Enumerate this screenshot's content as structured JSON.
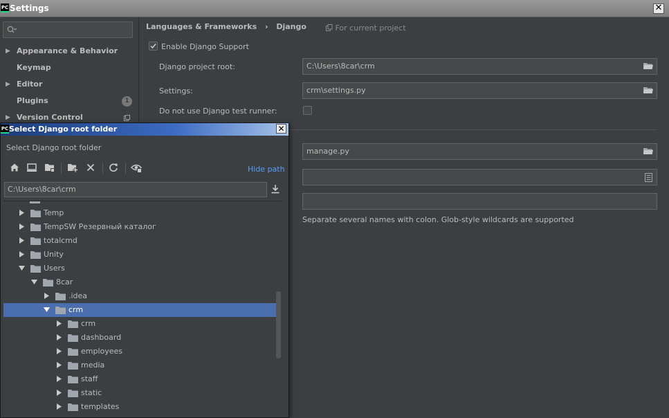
{
  "window": {
    "title": "Settings",
    "app_icon": "PC",
    "close": "✕"
  },
  "sidebar": {
    "search_placeholder": "Q",
    "items": [
      {
        "label": "Appearance & Behavior",
        "arrow": "▶"
      },
      {
        "label": "Keymap",
        "arrow": ""
      },
      {
        "label": "Editor",
        "arrow": "▶"
      },
      {
        "label": "Plugins",
        "arrow": "",
        "badge": "1"
      },
      {
        "label": "Version Control",
        "arrow": "▶"
      }
    ]
  },
  "content": {
    "breadcrumb_part1": "Languages & Frameworks",
    "breadcrumb_sep": "›",
    "breadcrumb_part2": "Django",
    "for_project": "For current project",
    "enable_label": "Enable Django Support",
    "enable_checked": true,
    "project_root_label": "Django project root:",
    "project_root_value": "C:\\Users\\8car\\crm",
    "settings_label": "Settings:",
    "settings_value": "crm\\settings.py",
    "no_test_runner_label": "Do not use Django test runner:",
    "manage_value": "manage.py",
    "templates_value": "",
    "folder_pattern_value": "",
    "hint": "Separate several names with colon. Glob-style wildcards are supported"
  },
  "dialog": {
    "title": "Select Django root folder",
    "close": "✕",
    "description": "Select Django root folder",
    "hide_path": "Hide path",
    "path_value": "C:\\Users\\8car\\crm",
    "tree": [
      {
        "name": "Temp",
        "level": 1,
        "expanded": false,
        "selected": false
      },
      {
        "name": "TempSW Резервный каталог",
        "level": 1,
        "expanded": false,
        "selected": false
      },
      {
        "name": "totalcmd",
        "level": 1,
        "expanded": false,
        "selected": false
      },
      {
        "name": "Unity",
        "level": 1,
        "expanded": false,
        "selected": false
      },
      {
        "name": "Users",
        "level": 1,
        "expanded": true,
        "selected": false
      },
      {
        "name": "8car",
        "level": 2,
        "expanded": true,
        "selected": false
      },
      {
        "name": ".idea",
        "level": 3,
        "expanded": false,
        "selected": false
      },
      {
        "name": "crm",
        "level": 3,
        "expanded": true,
        "selected": true
      },
      {
        "name": "crm",
        "level": 4,
        "expanded": false,
        "selected": false
      },
      {
        "name": "dashboard",
        "level": 4,
        "expanded": false,
        "selected": false
      },
      {
        "name": "employees",
        "level": 4,
        "expanded": false,
        "selected": false
      },
      {
        "name": "media",
        "level": 4,
        "expanded": false,
        "selected": false
      },
      {
        "name": "staff",
        "level": 4,
        "expanded": false,
        "selected": false
      },
      {
        "name": "static",
        "level": 4,
        "expanded": false,
        "selected": false
      },
      {
        "name": "templates",
        "level": 4,
        "expanded": false,
        "selected": false
      }
    ]
  },
  "colors": {
    "background": "#3c3f41",
    "selection": "#4b6eaf",
    "link": "#589df6",
    "folder": "#a0a7ae"
  }
}
